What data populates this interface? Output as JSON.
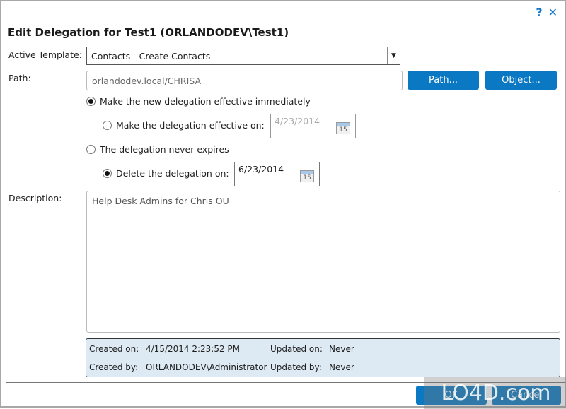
{
  "window": {
    "help_icon": "?",
    "close_icon": "✕",
    "title": "Edit Delegation for Test1 (ORLANDODEV\\Test1)"
  },
  "form": {
    "active_template_label": "Active Template:",
    "active_template_value": "Contacts - Create Contacts",
    "path_label": "Path:",
    "path_value": "orlandodev.local/CHRISA",
    "path_button": "Path...",
    "object_button": "Object...",
    "radio_effective_immediately": "Make the new delegation effective immediately",
    "radio_effective_on": "Make the delegation effective on:",
    "effective_date": "4/23/2014",
    "radio_never_expires": "The delegation never expires",
    "radio_delete_on": "Delete the delegation on:",
    "delete_date": "6/23/2014",
    "calendar_day": "15",
    "description_label": "Description:",
    "description_value": "Help Desk Admins for Chris OU"
  },
  "info": {
    "created_on_label": "Created on:",
    "created_on_value": "4/15/2014 2:23:52 PM",
    "updated_on_label": "Updated on:",
    "updated_on_value": "Never",
    "created_by_label": "Created by:",
    "created_by_value": "ORLANDODEV\\Administrator",
    "updated_by_label": "Updated by:",
    "updated_by_value": "Never"
  },
  "footer": {
    "ok_button": "OK",
    "cancel_button": "Cancel"
  },
  "watermark": "LO4D.com"
}
